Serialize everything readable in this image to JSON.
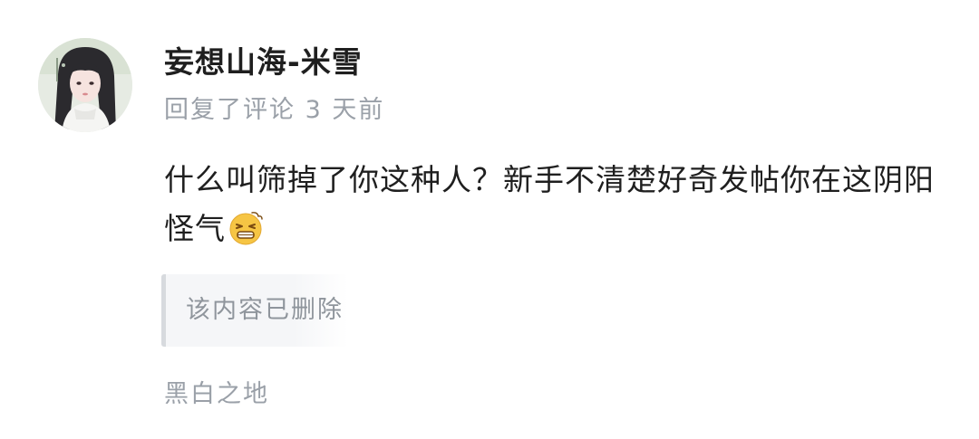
{
  "user": {
    "name": "妄想山海-米雪",
    "avatar_icon": "user-avatar-illustration"
  },
  "meta": {
    "action": "回复了评论",
    "time": "3 天前",
    "full": "回复了评论 3 天前"
  },
  "comment": {
    "text": "什么叫筛掉了你这种人？新手不清楚好奇发帖你在这阴阳怪气",
    "emoji_icon": "tired-face-emoji"
  },
  "quote": {
    "text": "该内容已删除"
  },
  "topic": {
    "name": "黑白之地"
  },
  "colors": {
    "primary_text": "#1f1f1f",
    "secondary_text": "#9aa0a8",
    "quote_bg": "#f5f6f8",
    "quote_bar": "#d7dade",
    "emoji_yellow": "#f6c544"
  }
}
